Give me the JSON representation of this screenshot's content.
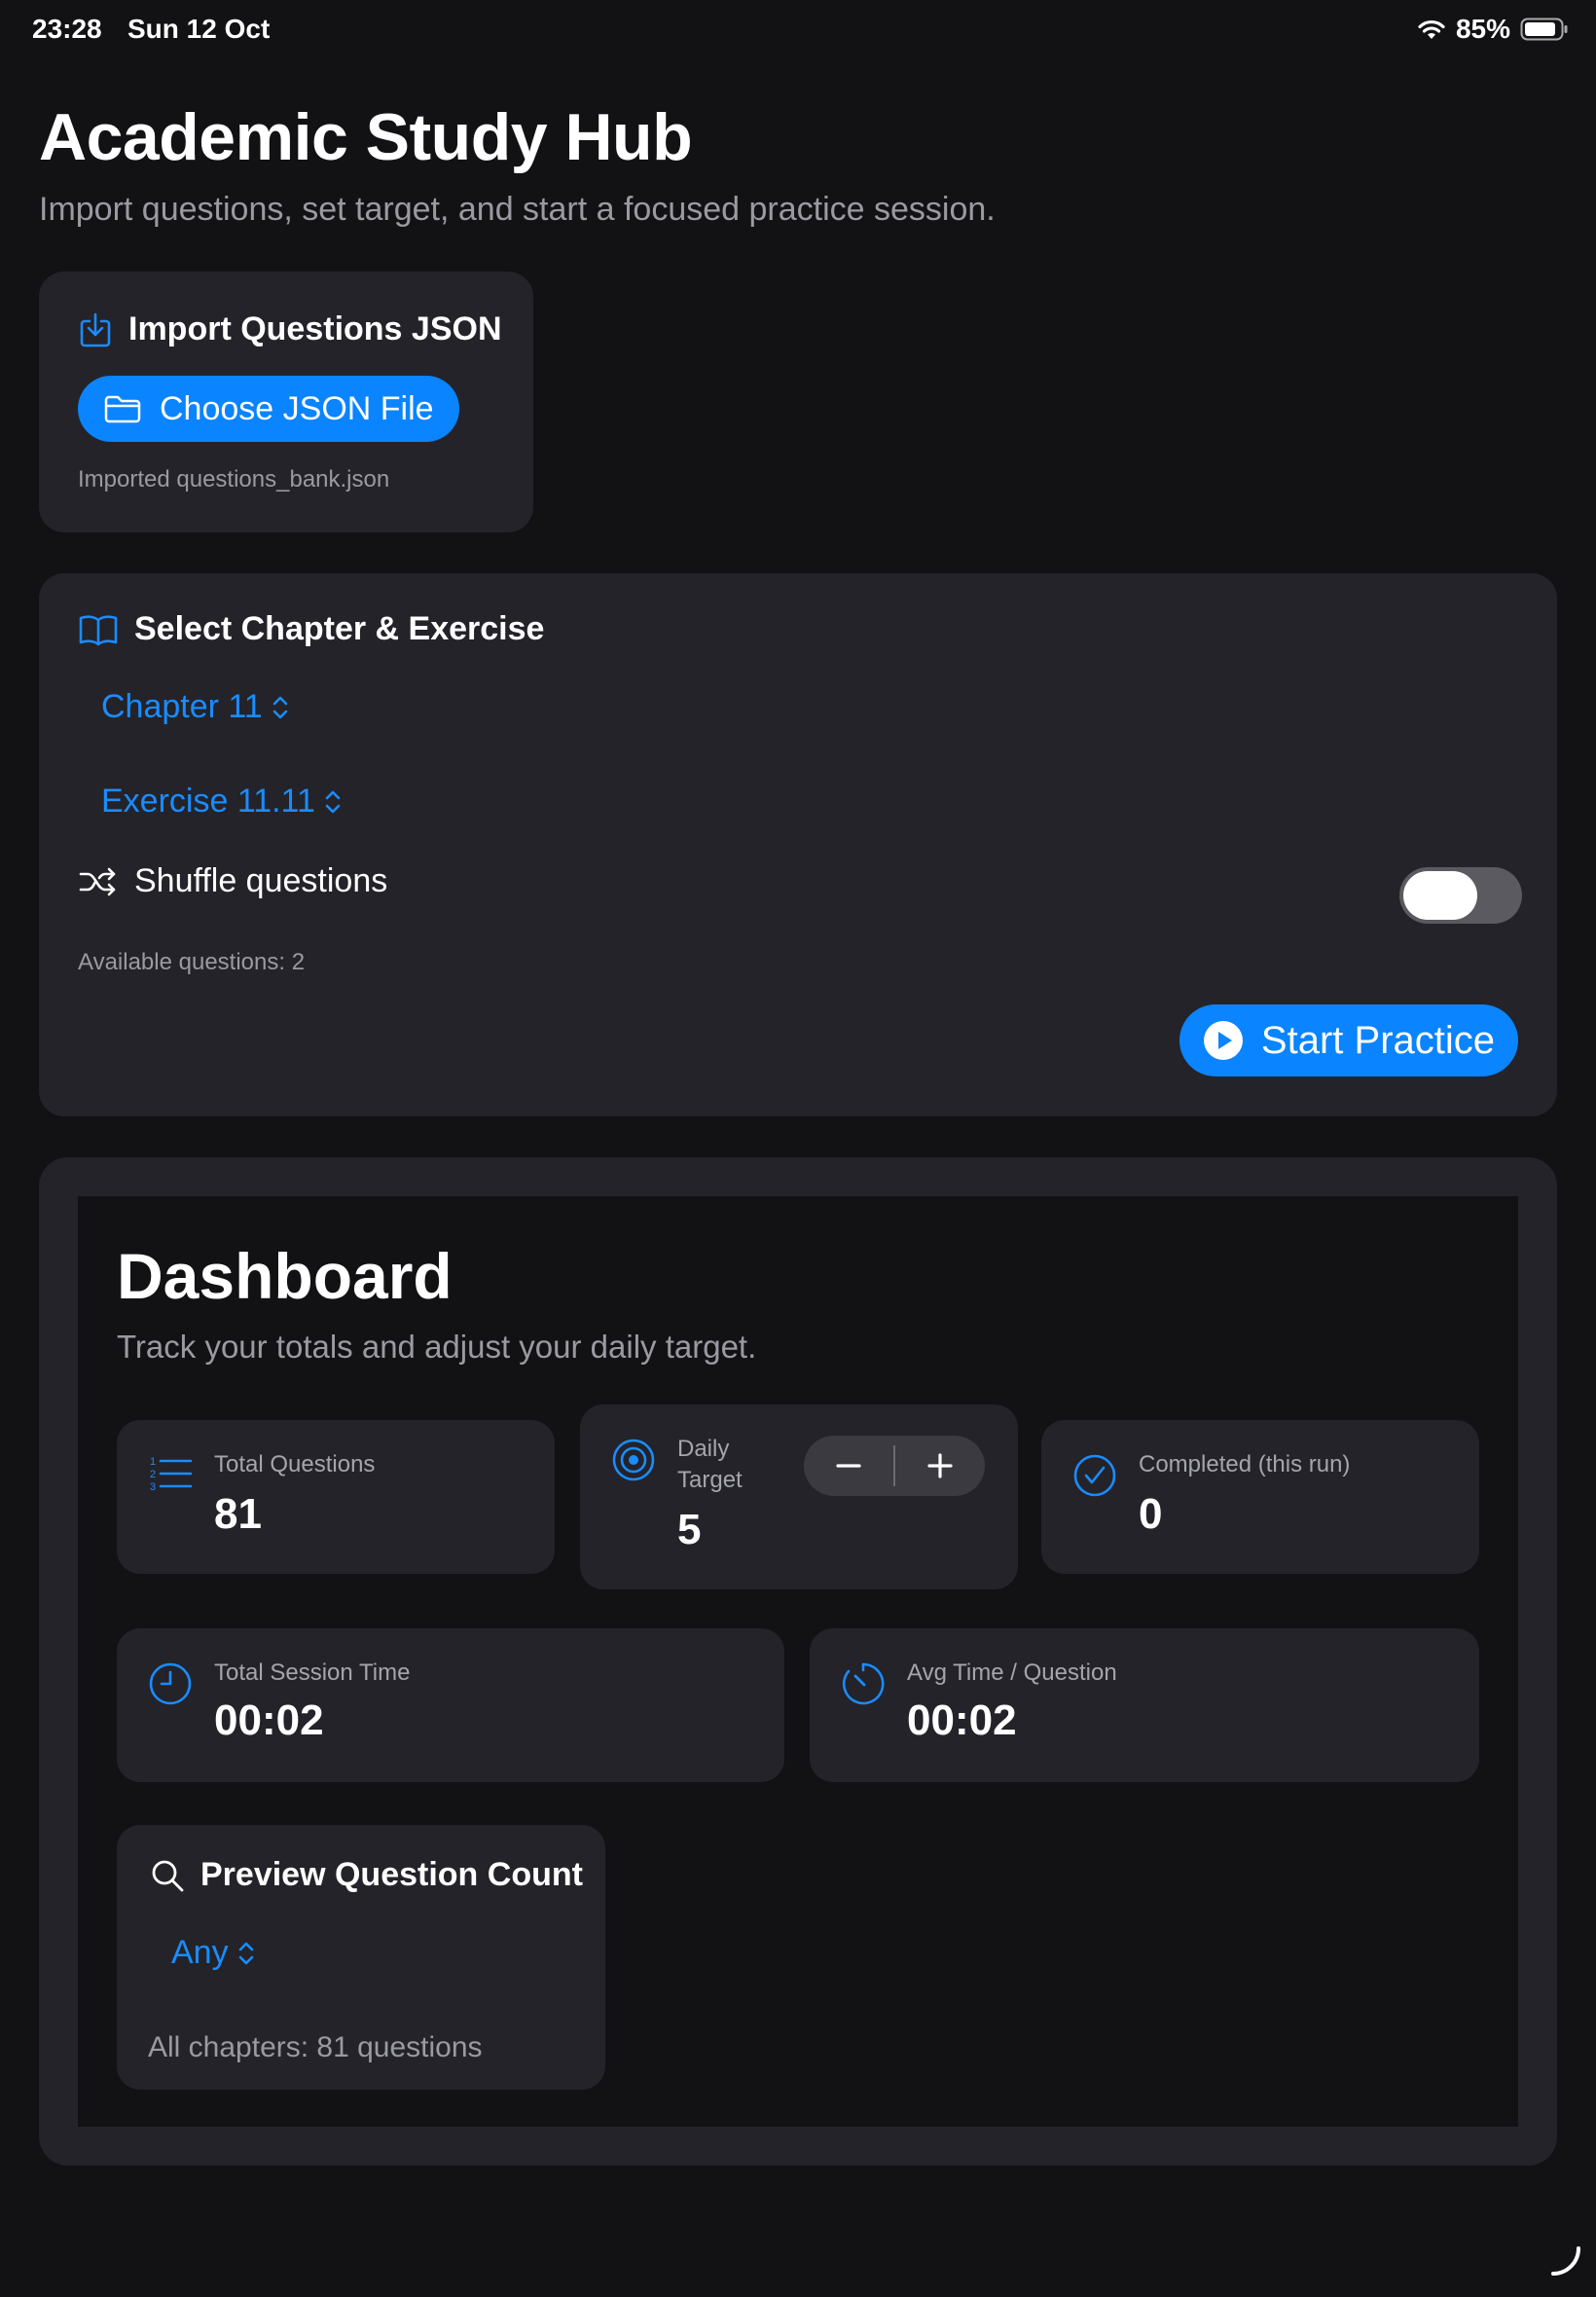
{
  "status_bar": {
    "time": "23:28",
    "date": "Sun 12 Oct",
    "battery": "85%"
  },
  "header": {
    "title": "Academic Study Hub",
    "subtitle": "Import questions, set target, and start a focused practice session."
  },
  "import_card": {
    "heading": "Import Questions JSON",
    "button_label": "Choose JSON File",
    "status": "Imported questions_bank.json"
  },
  "select_card": {
    "heading": "Select Chapter & Exercise",
    "chapter": "Chapter 11",
    "exercise": "Exercise 11.11",
    "shuffle_label": "Shuffle questions",
    "shuffle_on": false,
    "available": "Available questions: 2",
    "start_label": "Start Practice"
  },
  "dashboard": {
    "title": "Dashboard",
    "subtitle": "Track your totals and adjust your daily target.",
    "total_questions": {
      "label": "Total Questions",
      "value": "81"
    },
    "daily_target": {
      "label": "Daily\nTarget",
      "value": "5"
    },
    "completed": {
      "label": "Completed (this run)",
      "value": "0"
    },
    "total_time": {
      "label": "Total Session Time",
      "value": "00:02"
    },
    "avg_time": {
      "label": "Avg Time / Question",
      "value": "00:02"
    },
    "preview": {
      "heading": "Preview Question Count",
      "selected": "Any",
      "summary": "All chapters: 81 questions"
    }
  },
  "colors": {
    "accent": "#0a84ff",
    "background": "#121215",
    "card": "#232329"
  }
}
